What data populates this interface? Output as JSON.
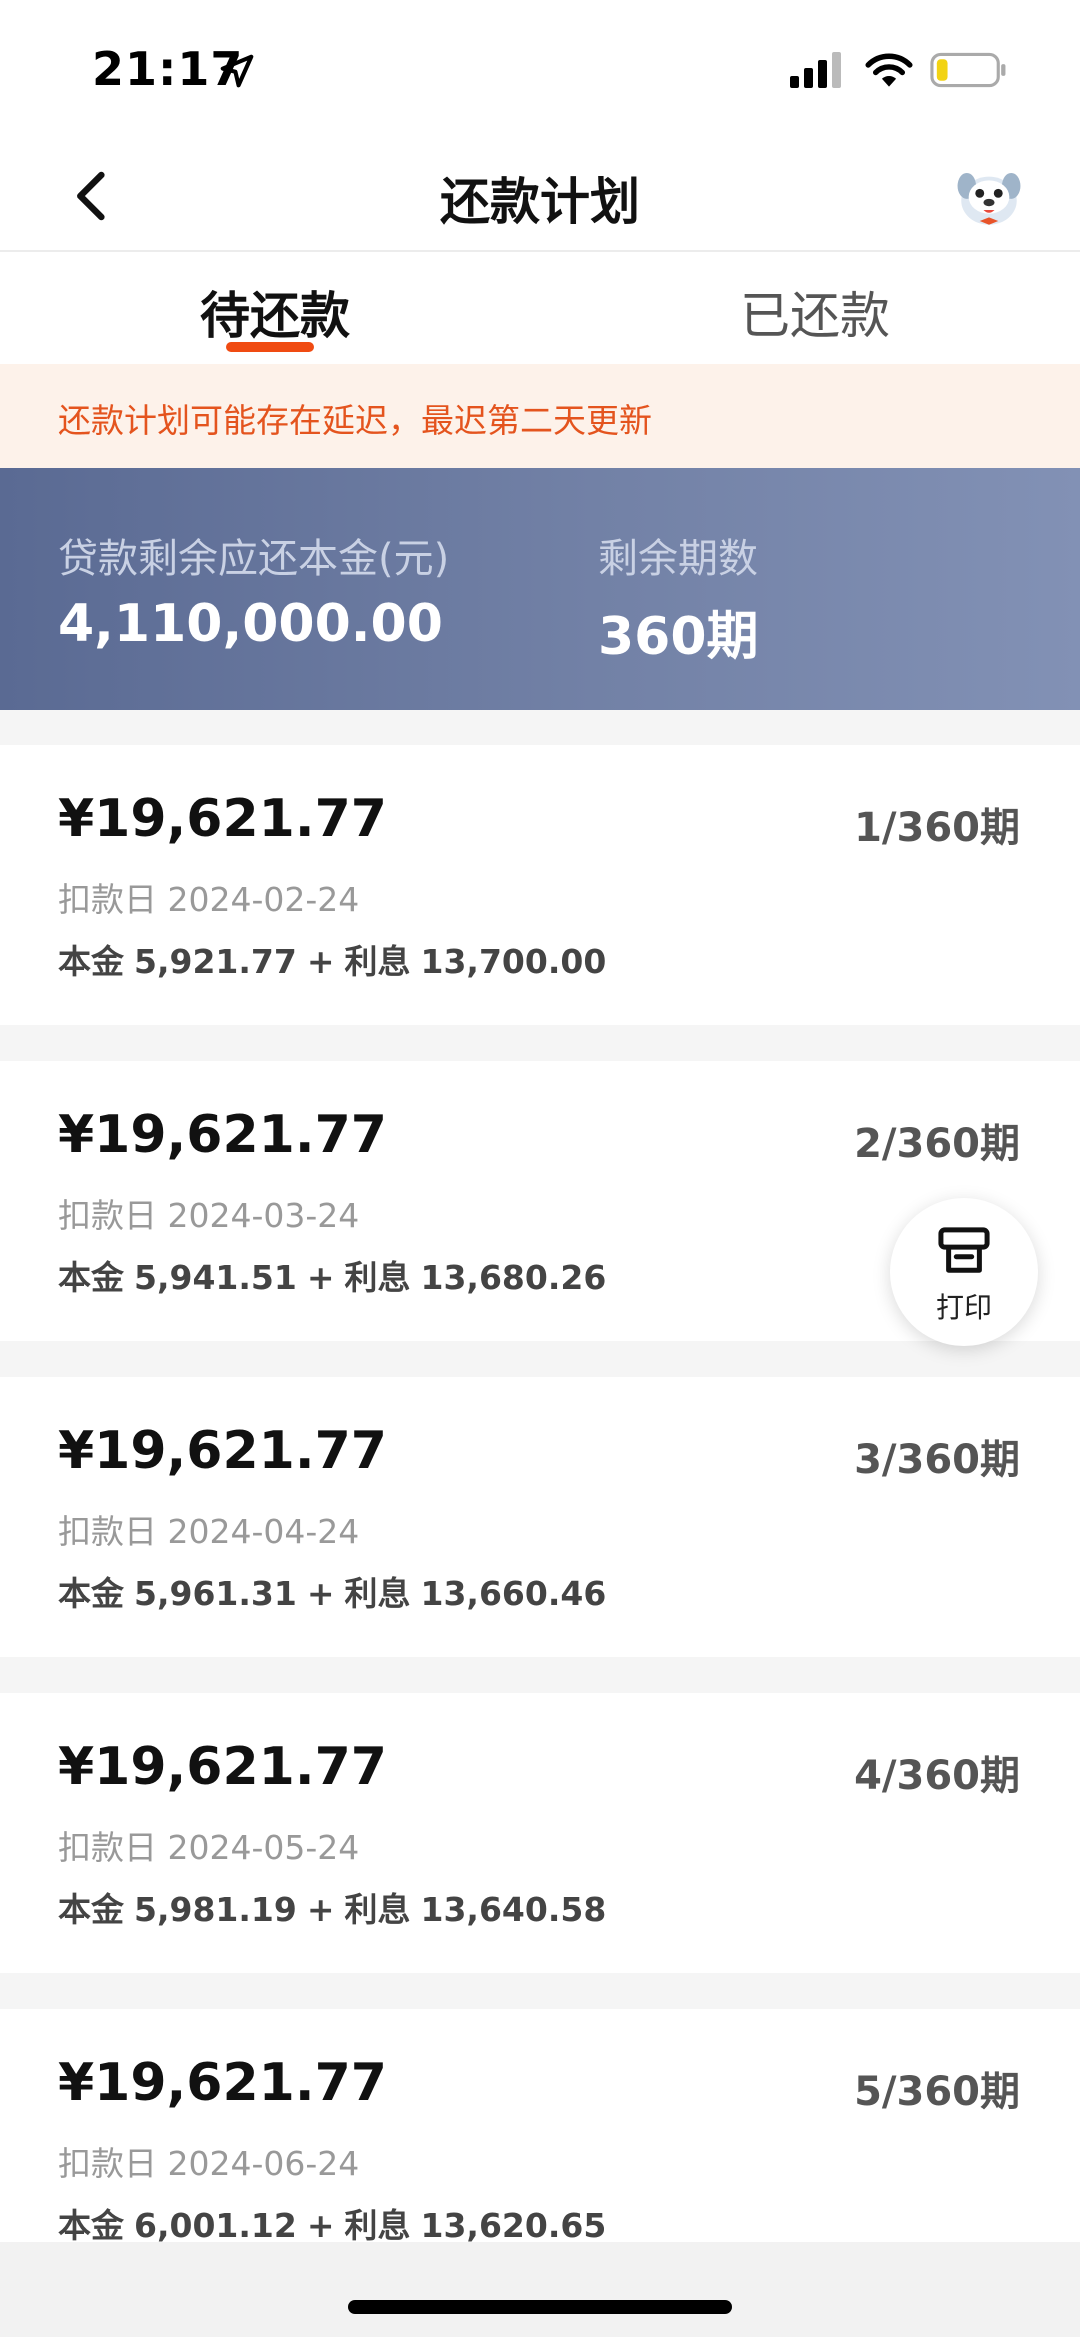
{
  "status_bar": {
    "time": "21:17"
  },
  "nav": {
    "title": "还款计划"
  },
  "tabs": [
    {
      "label": "待还款",
      "active": true
    },
    {
      "label": "已还款",
      "active": false
    }
  ],
  "notice": {
    "text": "还款计划可能存在延迟，最迟第二天更新"
  },
  "summary": {
    "principal_label": "贷款剩余应还本金(元)",
    "principal_value": "4,110,000.00",
    "periods_label": "剩余期数",
    "periods_value": "360期"
  },
  "installments": [
    {
      "amount": "¥19,621.77",
      "period": "1/360期",
      "date_label": "扣款日",
      "date": "2024-02-24",
      "principal_label": "本金",
      "principal": "5,921.77",
      "plus": "+",
      "interest_label": "利息",
      "interest": "13,700.00"
    },
    {
      "amount": "¥19,621.77",
      "period": "2/360期",
      "date_label": "扣款日",
      "date": "2024-03-24",
      "principal_label": "本金",
      "principal": "5,941.51",
      "plus": "+",
      "interest_label": "利息",
      "interest": "13,680.26"
    },
    {
      "amount": "¥19,621.77",
      "period": "3/360期",
      "date_label": "扣款日",
      "date": "2024-04-24",
      "principal_label": "本金",
      "principal": "5,961.31",
      "plus": "+",
      "interest_label": "利息",
      "interest": "13,660.46"
    },
    {
      "amount": "¥19,621.77",
      "period": "4/360期",
      "date_label": "扣款日",
      "date": "2024-05-24",
      "principal_label": "本金",
      "principal": "5,981.19",
      "plus": "+",
      "interest_label": "利息",
      "interest": "13,640.58"
    },
    {
      "amount": "¥19,621.77",
      "period": "5/360期",
      "date_label": "扣款日",
      "date": "2024-06-24",
      "principal_label": "本金",
      "principal": "6,001.12",
      "plus": "+",
      "interest_label": "利息",
      "interest": "13,620.65"
    }
  ],
  "print": {
    "label": "打印"
  },
  "colors": {
    "accent": "#f04b12",
    "notice_text": "#e4541e",
    "summary_bg": "#6b7aa0"
  }
}
